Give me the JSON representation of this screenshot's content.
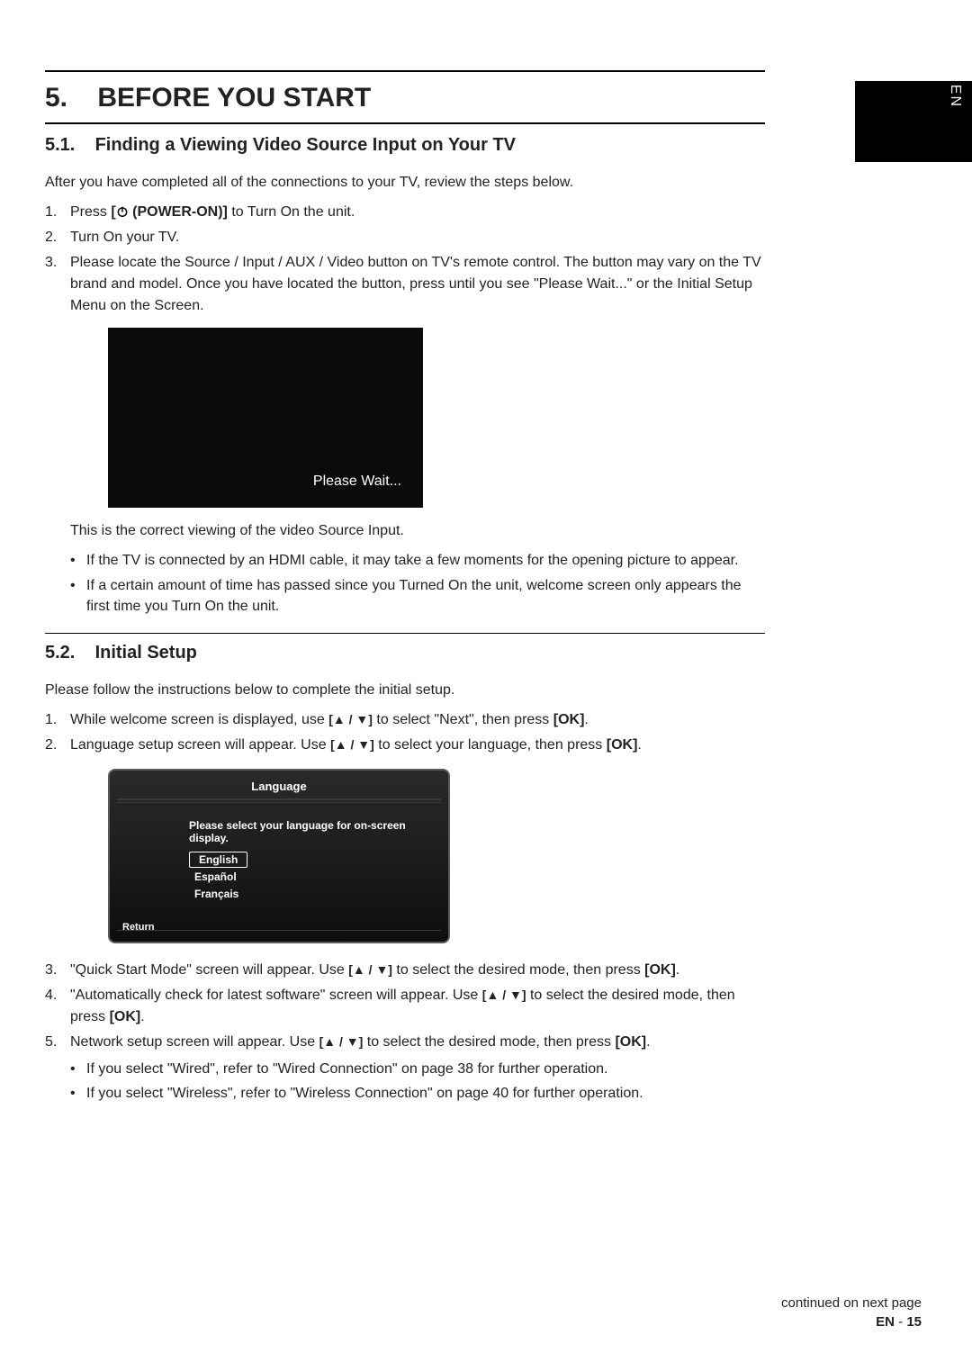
{
  "sidebar": {
    "lang_tab": "EN"
  },
  "section": {
    "num": "5.",
    "title": "BEFORE YOU START",
    "s1": {
      "num": "5.1.",
      "title": "Finding a Viewing Video Source Input on Your TV",
      "intro": "After you have completed all of the connections to your TV, review the steps below.",
      "step1_pre": "Press ",
      "step1_bracket_open": "[",
      "step1_power": " (POWER-ON)]",
      "step1_post": " to Turn On the unit.",
      "step2": "Turn On your TV.",
      "step3": "Please locate the Source / Input / AUX / Video button on TV's remote control.  The button may vary on the TV brand and model. Once you have located the button, press until you see \"Please Wait...\" or the Initial Setup Menu on the Screen.",
      "tv_wait": "Please Wait...",
      "below_tv": "This is the correct viewing of the video Source Input.",
      "bullet1": "If the TV is connected by an HDMI cable, it may take a few moments for the opening picture to appear.",
      "bullet2": "If a certain amount of time has passed since you Turned On the unit, welcome screen only appears the first time you Turn On the unit."
    },
    "s2": {
      "num": "5.2.",
      "title": "Initial Setup",
      "intro": "Please follow the instructions below to complete the initial setup.",
      "step1_a": "While welcome screen is displayed, use ",
      "step1_b": " to select \"Next\", then press ",
      "step2_a": "Language setup screen will appear. Use ",
      "step2_b": " to select your language, then press ",
      "osd": {
        "title": "Language",
        "prompt": "Please select your language for on-screen display.",
        "opts": [
          "English",
          "Español",
          "Français"
        ],
        "return": "Return"
      },
      "step3_a": "\"Quick Start Mode\" screen will appear. Use ",
      "step3_b": " to select the desired mode, then press ",
      "step4_a": " \"Automatically check for latest software\" screen will appear. Use ",
      "step4_b": " to select the desired mode, then press ",
      "step5_a": "Network setup screen will appear. Use ",
      "step5_b": " to select the desired mode, then press ",
      "sub1": "If you select \"Wired\", refer to \"Wired Connection\" on page 38 for further operation.",
      "sub2": "If you select \"Wireless\", refer to \"Wireless Connection\" on page 40 for further operation."
    }
  },
  "glyphs": {
    "arrows": "[▲ / ▼]",
    "ok": "[OK]",
    "period": "."
  },
  "footer": {
    "continued": "continued on next page",
    "lang": "EN",
    "sep": " - ",
    "page": "15"
  },
  "list_nums": {
    "n1": "1.",
    "n2": "2.",
    "n3": "3.",
    "n4": "4.",
    "n5": "5."
  }
}
